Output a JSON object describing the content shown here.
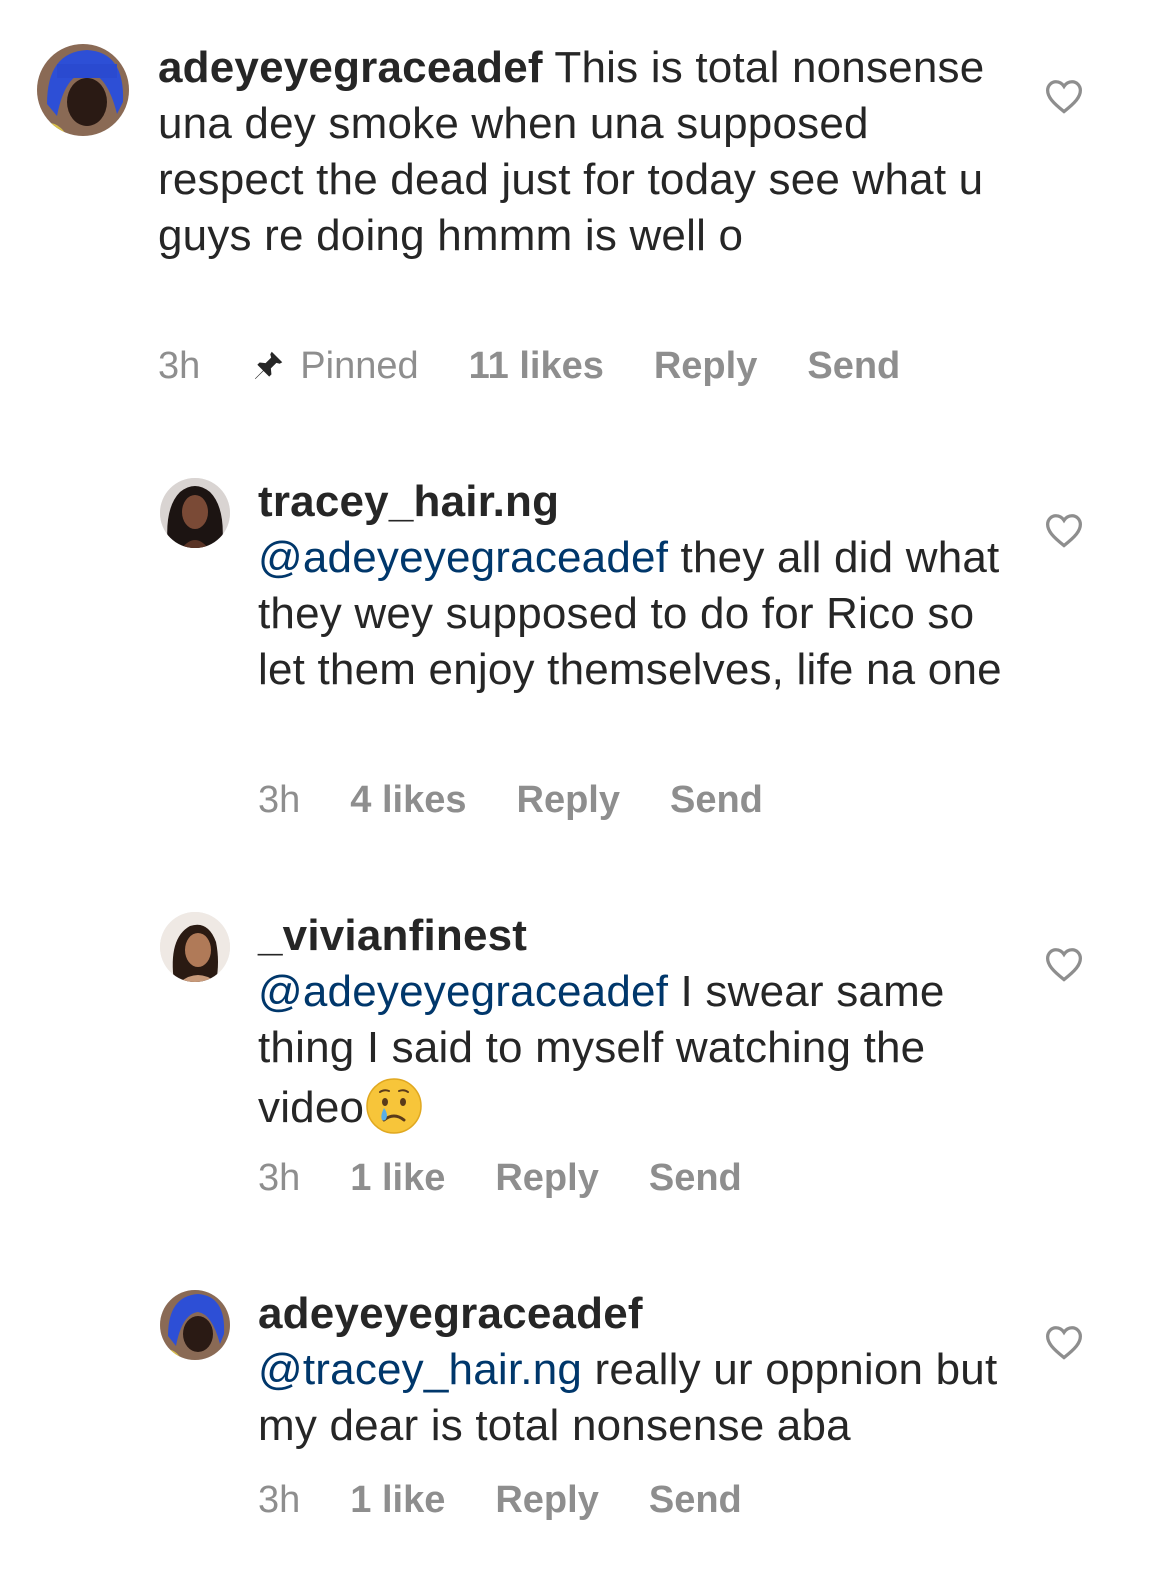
{
  "comments": [
    {
      "username": "adeyeyegraceadef",
      "mention": "",
      "text": " This is total nonsense una dey smoke when una supposed respect the dead just for today see what u guys re doing hmmm is well o",
      "time": "3h",
      "pinned_label": "Pinned",
      "likes": "11 likes",
      "reply_label": "Reply",
      "send_label": "Send"
    },
    {
      "username": "tracey_hair.ng",
      "mention": "@adeyeyegraceadef",
      "text": " they all did what they wey supposed to do for Rico so let them enjoy themselves, life na one",
      "time": "3h",
      "likes": "4 likes",
      "reply_label": "Reply",
      "send_label": "Send"
    },
    {
      "username": "_vivianfinest",
      "mention": "@adeyeyegraceadef",
      "text": " I swear same thing I said to myself watching the video",
      "emoji": "crying-face",
      "time": "3h",
      "likes": "1 like",
      "reply_label": "Reply",
      "send_label": "Send"
    },
    {
      "username": "adeyeyegraceadef",
      "mention": "@tracey_hair.ng",
      "text": " really ur oppnion but my dear is total nonsense aba",
      "time": "3h",
      "likes": "1 like",
      "reply_label": "Reply",
      "send_label": "Send"
    }
  ],
  "icons": {
    "like": "heart-outline-icon",
    "pin": "pin-icon"
  },
  "colors": {
    "text": "#262626",
    "mention": "#00376b",
    "meta": "#8e8e8e",
    "background": "#ffffff"
  }
}
